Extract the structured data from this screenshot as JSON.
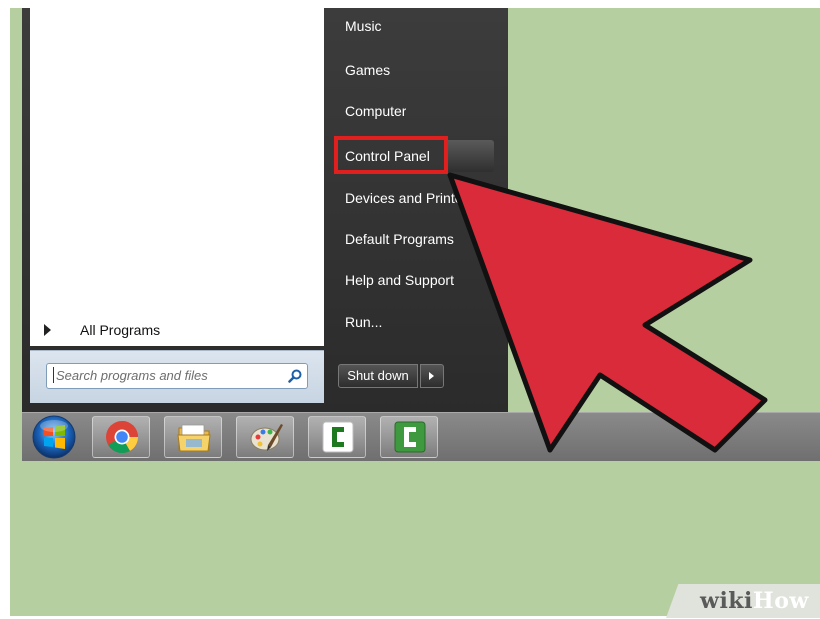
{
  "start_menu": {
    "all_programs_label": "All Programs",
    "search_placeholder": "Search programs and files",
    "right_items": [
      {
        "label": "Music"
      },
      {
        "label": "Games"
      },
      {
        "label": "Computer"
      },
      {
        "label": "Control Panel",
        "highlighted": true
      },
      {
        "label": "Devices and Printers"
      },
      {
        "label": "Default Programs"
      },
      {
        "label": "Help and Support"
      },
      {
        "label": "Run..."
      }
    ],
    "shutdown_label": "Shut down"
  },
  "taskbar": {
    "items": [
      {
        "icon": "windows-start-orb-icon"
      },
      {
        "icon": "chrome-icon"
      },
      {
        "icon": "file-explorer-icon"
      },
      {
        "icon": "paint-icon"
      },
      {
        "icon": "camtasia-icon"
      },
      {
        "icon": "camtasia-recorder-icon"
      }
    ]
  },
  "annotation": {
    "arrow_color": "#d92b3a",
    "highlight_color": "#e01f1f"
  },
  "watermark": {
    "wiki": "wiki",
    "how": "How"
  }
}
